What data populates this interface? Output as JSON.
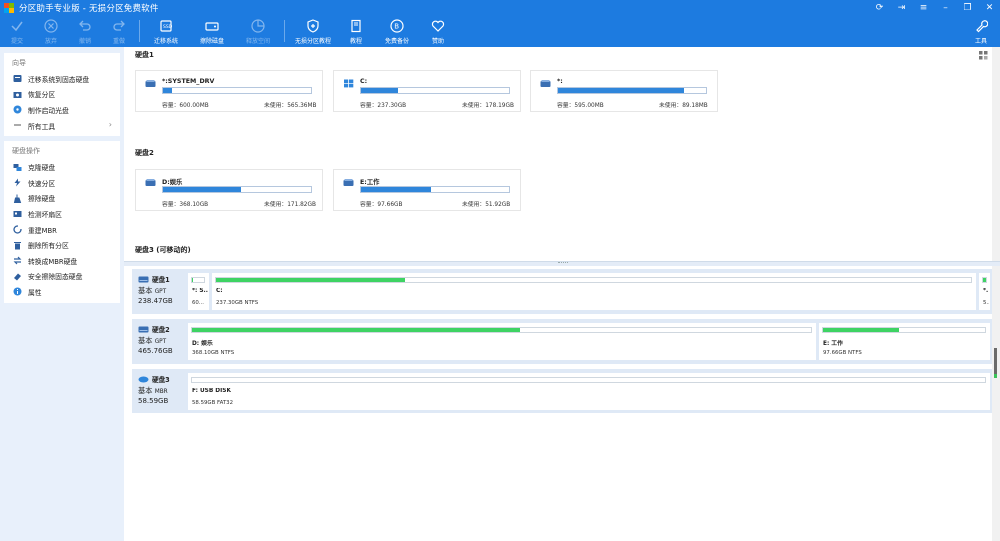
{
  "window": {
    "title": "分区助手专业版 - 无损分区免费软件"
  },
  "toolbar": {
    "buttons": [
      {
        "label": "提交",
        "icon": "check-icon",
        "enabled": false
      },
      {
        "label": "放弃",
        "icon": "cancel-icon",
        "enabled": false
      },
      {
        "label": "撤销",
        "icon": "undo-icon",
        "enabled": false
      },
      {
        "label": "重做",
        "icon": "redo-icon",
        "enabled": false
      },
      {
        "label": "迁移系统",
        "icon": "migrate-os-icon",
        "enabled": true
      },
      {
        "label": "擦除磁盘",
        "icon": "wipe-disk-icon",
        "enabled": true
      },
      {
        "label": "释放空间",
        "icon": "free-space-icon",
        "enabled": false
      },
      {
        "label": "无损分区教程",
        "icon": "shield-icon",
        "enabled": true
      },
      {
        "label": "教程",
        "icon": "book-icon",
        "enabled": true
      },
      {
        "label": "免费备份",
        "icon": "backup-icon",
        "enabled": true
      },
      {
        "label": "赞助",
        "icon": "heart-icon",
        "enabled": true
      }
    ],
    "tools_label": "工具"
  },
  "sidebar": {
    "wizard": {
      "heading": "向导",
      "items": [
        {
          "label": "迁移系统到固态硬盘",
          "icon": "migrate-icon"
        },
        {
          "label": "恢复分区",
          "icon": "recover-icon"
        },
        {
          "label": "制作启动光盘",
          "icon": "boot-disc-icon"
        },
        {
          "label": "所有工具",
          "icon": "tools-icon",
          "chevron": "›"
        }
      ]
    },
    "disk_ops": {
      "heading": "硬盘操作",
      "items": [
        {
          "label": "克隆硬盘",
          "icon": "clone-icon"
        },
        {
          "label": "快速分区",
          "icon": "lightning-icon"
        },
        {
          "label": "擦除硬盘",
          "icon": "broom-icon"
        },
        {
          "label": "检测坏扇区",
          "icon": "scan-icon"
        },
        {
          "label": "重建MBR",
          "icon": "rebuild-icon"
        },
        {
          "label": "删除所有分区",
          "icon": "trash-icon"
        },
        {
          "label": "转换成MBR硬盘",
          "icon": "convert-icon"
        },
        {
          "label": "安全擦除固态硬盘",
          "icon": "ssd-erase-icon"
        },
        {
          "label": "属性",
          "icon": "info-icon"
        }
      ]
    }
  },
  "overview": {
    "cap_label": "容量：",
    "free_label": "未使用：",
    "disks": [
      {
        "title": "硬盘1",
        "partitions": [
          {
            "name": "*:SYSTEM_DRV",
            "capacity": "600.00MB",
            "free": "565.36MB",
            "used_fraction": 0.06,
            "icon": "drive-icon"
          },
          {
            "name": "C:",
            "capacity": "237.30GB",
            "free": "178.19GB",
            "used_fraction": 0.25,
            "icon": "windows-icon"
          },
          {
            "name": "*:",
            "capacity": "595.00MB",
            "free": "89.18MB",
            "used_fraction": 0.85,
            "icon": "drive-icon"
          }
        ]
      },
      {
        "title": "硬盘2",
        "partitions": [
          {
            "name": "D:娱乐",
            "capacity": "368.10GB",
            "free": "171.82GB",
            "used_fraction": 0.53,
            "icon": "drive-icon"
          },
          {
            "name": "E:工作",
            "capacity": "97.66GB",
            "free": "51.92GB",
            "used_fraction": 0.47,
            "icon": "drive-icon"
          }
        ]
      },
      {
        "title": "硬盘3 (可移动的)",
        "partitions": []
      }
    ]
  },
  "disk_map": [
    {
      "name": "硬盘1",
      "type": "基本",
      "style": "GPT",
      "size": "238.47GB",
      "segments": [
        {
          "name": "*: S...",
          "info": "60...",
          "used_fraction": 0.1
        },
        {
          "name": "C:",
          "info": "237.30GB NTFS",
          "used_fraction": 0.25
        },
        {
          "name": "*.",
          "info": "5...",
          "used_fraction": 0.85
        }
      ]
    },
    {
      "name": "硬盘2",
      "type": "基本",
      "style": "GPT",
      "size": "465.76GB",
      "segments": [
        {
          "name": "D: 娱乐",
          "info": "368.10GB NTFS",
          "used_fraction": 0.53
        },
        {
          "name": "E: 工作",
          "info": "97.66GB NTFS",
          "used_fraction": 0.47
        }
      ]
    },
    {
      "name": "硬盘3",
      "type": "基本",
      "style": "MBR",
      "size": "58.59GB",
      "segments": [
        {
          "name": "F: USB DISK",
          "info": "58.59GB FAT32",
          "used_fraction": 0.0
        }
      ]
    }
  ],
  "colors": {
    "brand_blue": "#1d7be0",
    "bar_blue": "#2f86db",
    "bar_green": "#3ed363",
    "sidebar_bg": "#e8f0fb",
    "disk_row_bg": "#dfe9f6"
  }
}
